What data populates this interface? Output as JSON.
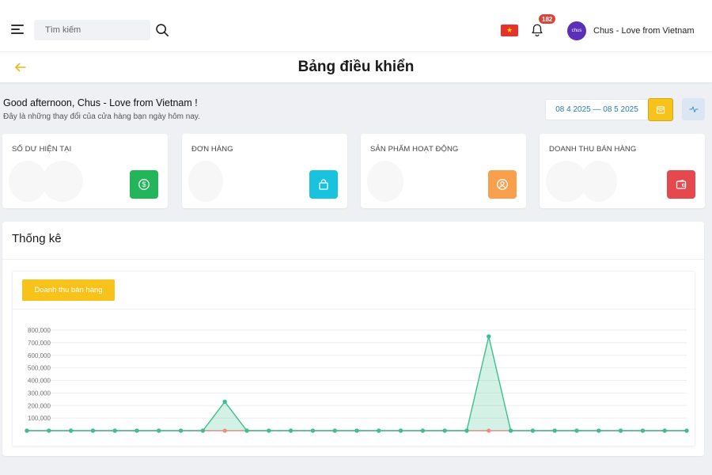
{
  "header": {
    "search_placeholder": "Tìm kiếm",
    "notification_count": "182",
    "avatar_text": "chus",
    "user_name": "Chus - Love from Vietnam",
    "flag_star": "★"
  },
  "page": {
    "title": "Bảng điều khiển"
  },
  "greeting": {
    "title": "Good afternoon, Chus - Love from Vietnam !",
    "subtitle": "Đây là những thay đổi của cửa hàng bạn ngày hôm nay.",
    "date_range": "08 4 2025 — 08 5 2025"
  },
  "cards": [
    {
      "title": "SỐ DƯ HIỆN TẠI",
      "icon": "dollar-icon",
      "color": "#22b55a"
    },
    {
      "title": "ĐƠN HÀNG",
      "icon": "shopping-bag-icon",
      "color": "#19c3e0"
    },
    {
      "title": "SẢN PHẨM HOẠT ĐỘNG",
      "icon": "user-circle-icon",
      "color": "#f8a04c"
    },
    {
      "title": "DOANH THU BÁN HÀNG",
      "icon": "wallet-icon",
      "color": "#e5484d"
    }
  ],
  "stats": {
    "title": "Thống kê",
    "tab_label": "Doanh thu bán hàng"
  },
  "chart_data": {
    "type": "area",
    "title": "",
    "xlabel": "",
    "ylabel": "",
    "ylim": [
      0,
      800000
    ],
    "y_ticks": [
      "800,000",
      "700,000",
      "600,000",
      "500,000",
      "400,000",
      "300,000",
      "200,000",
      "100,000"
    ],
    "grid": true,
    "colors": {
      "primary": "#3cbf8f",
      "secondary": "#f28b82"
    },
    "series": [
      {
        "color": "#3cbf8f",
        "values": [
          0,
          0,
          0,
          0,
          0,
          0,
          0,
          0,
          0,
          230000,
          0,
          0,
          0,
          0,
          0,
          0,
          0,
          0,
          0,
          0,
          0,
          750000,
          0,
          0,
          0,
          0,
          0,
          0,
          0,
          0,
          0
        ]
      },
      {
        "color": "#f28b82",
        "values": [
          0,
          0,
          0,
          0,
          0,
          0,
          0,
          0,
          0,
          0,
          0,
          0,
          0,
          0,
          0,
          0,
          0,
          0,
          0,
          0,
          0,
          0,
          0,
          0,
          0,
          0,
          0,
          0,
          0,
          0,
          0
        ]
      }
    ]
  }
}
